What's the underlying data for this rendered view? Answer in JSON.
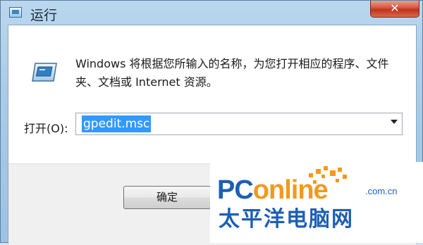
{
  "window": {
    "title": "运行",
    "close_glyph": "✕"
  },
  "dialog": {
    "description": "Windows 将根据您所输入的名称，为您打开相应的程序、文件夹、文档或 Internet 资源。",
    "open_label": "打开(O):",
    "open_value": "gpedit.msc",
    "ok_label": "确定"
  },
  "watermark": {
    "brand_pc": "PC",
    "brand_online": "online",
    "brand_domain": ".com.cn",
    "brand_cn": "太平洋电脑网"
  },
  "colors": {
    "selection": "#3399ff",
    "close_button": "#c0311b",
    "brand_blue": "#1d5fb4",
    "brand_orange": "#f19a1e"
  }
}
